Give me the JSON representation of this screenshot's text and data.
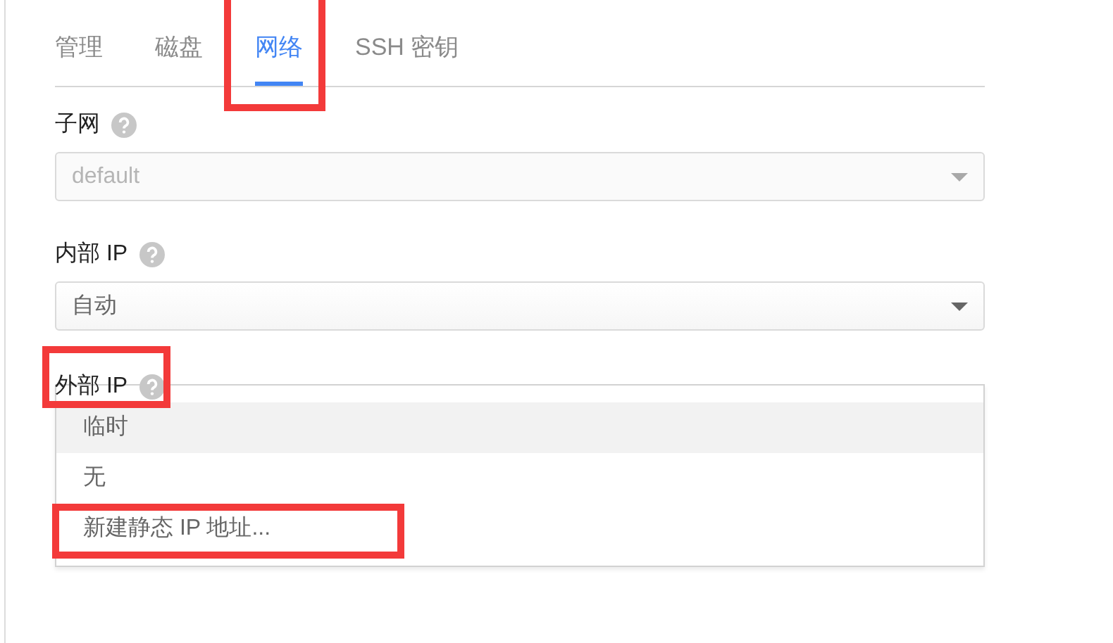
{
  "tabs": [
    {
      "label": "管理",
      "selected": false,
      "annotated": false
    },
    {
      "label": "磁盘",
      "selected": false,
      "annotated": false
    },
    {
      "label": "网络",
      "selected": true,
      "annotated": true
    },
    {
      "label": "SSH 密钥",
      "selected": false,
      "annotated": false
    }
  ],
  "fields": [
    {
      "label": "子网",
      "annotated": false,
      "kind": "select",
      "value": "default",
      "disabled": true
    },
    {
      "label": "内部 IP",
      "annotated": false,
      "kind": "select",
      "value": "自动",
      "disabled": false
    },
    {
      "label": "外部 IP",
      "annotated": true,
      "kind": "menu",
      "options": [
        {
          "label": "临时",
          "selected": true,
          "annotated": false
        },
        {
          "label": "无",
          "selected": false,
          "annotated": false
        },
        {
          "label": "新建静态 IP 地址...",
          "selected": false,
          "annotated": true
        }
      ]
    }
  ]
}
